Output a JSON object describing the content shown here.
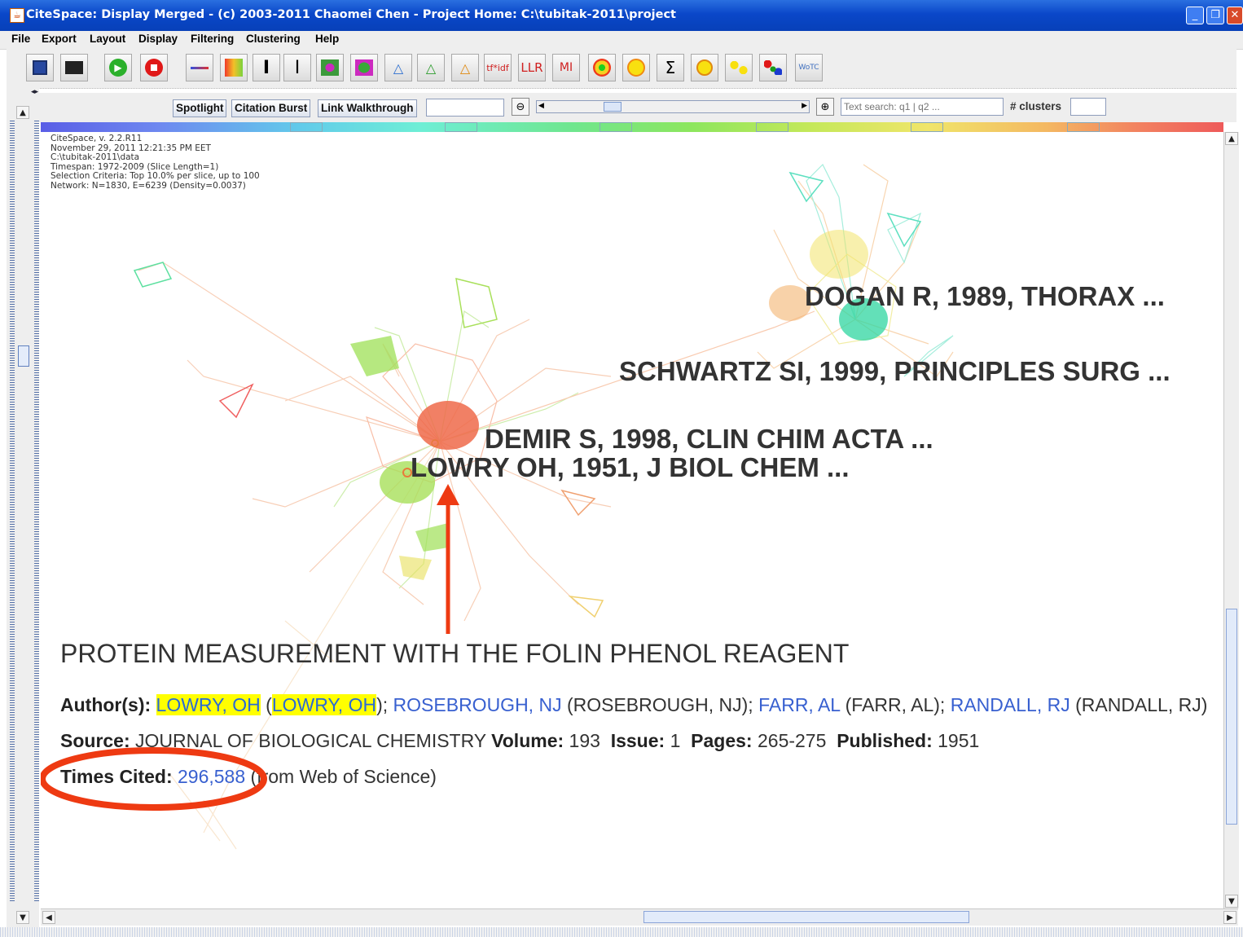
{
  "window": {
    "title": "CiteSpace: Display Merged - (c) 2003-2011 Chaomei Chen - Project Home: C:\\tubitak-2011\\project",
    "controls": [
      "_",
      "❐",
      "✕"
    ]
  },
  "menu": [
    "File",
    "Export",
    "Layout",
    "Display",
    "Filtering",
    "Clustering",
    "Help"
  ],
  "toolbar": {
    "text_buttons": {
      "tfidf": "tf*idf",
      "llr": "LLR",
      "mi": "MI",
      "wos": "WoTC"
    },
    "sigma": "Σ"
  },
  "controls": {
    "spotlight": "Spotlight",
    "citation_burst": "Citation Burst",
    "link_walkthrough": "Link Walkthrough",
    "search_placeholder": "Text search: q1 | q2 ...",
    "clusters_label": "# clusters"
  },
  "info_lines": [
    "CiteSpace, v. 2.2.R11",
    "November 29, 2011 12:21:35 PM EET",
    "C:\\tubitak-2011\\data",
    "Timespan: 1972-2009 (Slice Length=1)",
    "Selection Criteria: Top 10.0% per slice, up to 100",
    "Network: N=1830, E=6239 (Density=0.0037)"
  ],
  "node_labels": [
    "DOGAN R,  1989,  THORAX ...",
    "SCHWARTZ SI,  1999,  PRINCIPLES SURG ...",
    "DEMIR S,  1998,  CLIN CHIM ACTA ...",
    "LOWRY OH,  1951,  J BIOL CHEM ..."
  ],
  "record": {
    "title": "PROTEIN MEASUREMENT WITH THE FOLIN PHENOL REAGENT",
    "authors_label": "Author(s):",
    "author1": "LOWRY, OH",
    "author1_full": "LOWRY, OH",
    "author2": "ROSEBROUGH, NJ",
    "author2_full": "(ROSEBROUGH, NJ);",
    "author3": "FARR, AL",
    "author3_full": "(FARR, AL);",
    "author4": "RANDALL, RJ",
    "author4_full": "(RANDALL, RJ)",
    "source_label": "Source:",
    "source": "JOURNAL OF BIOLOGICAL CHEMISTRY",
    "volume_label": "Volume:",
    "volume": "193",
    "issue_label": "Issue:",
    "issue": "1",
    "pages_label": "Pages:",
    "pages": "265-275",
    "published_label": "Published:",
    "published": "1951",
    "times_cited_label": "Times Cited:",
    "times_cited": "296,588",
    "times_cited_source": "(from Web of Science)"
  },
  "colors": {
    "annotation": "#ee3a12",
    "highlight": "#ffff00",
    "link": "#3860d0"
  }
}
